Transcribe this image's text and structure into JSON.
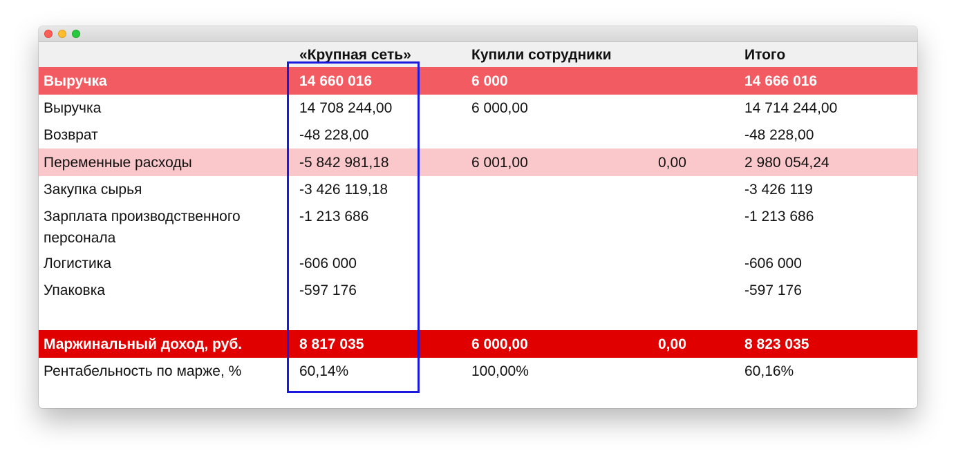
{
  "columns": {
    "label": "",
    "col1": "«Крупная сеть»",
    "col2": "Купили сотрудники",
    "col3": "",
    "total": "Итого"
  },
  "rows": [
    {
      "label": "Выручка",
      "col1": "14 660 016",
      "col2": "6 000",
      "col3": "",
      "total": "14 666 016"
    },
    {
      "label": "Выручка",
      "col1": "14 708 244,00",
      "col2": "6 000,00",
      "col3": "",
      "total": "14 714 244,00"
    },
    {
      "label": "Возврат",
      "col1": "-48 228,00",
      "col2": "",
      "col3": "",
      "total": "-48 228,00"
    },
    {
      "label": "Переменные расходы",
      "col1": "-5 842 981,18",
      "col2": "6 001,00",
      "col3": "0,00",
      "total": "2 980 054,24"
    },
    {
      "label": "Закупка сырья",
      "col1": "-3 426 119,18",
      "col2": "",
      "col3": "",
      "total": "-3 426 119"
    },
    {
      "label": "Зарплата производственного персонала",
      "col1": "-1 213 686",
      "col2": "",
      "col3": "",
      "total": "-1 213 686"
    },
    {
      "label": "Логистика",
      "col1": "-606 000",
      "col2": "",
      "col3": "",
      "total": "-606 000"
    },
    {
      "label": "Упаковка",
      "col1": "-597 176",
      "col2": "",
      "col3": "",
      "total": "-597 176"
    },
    {
      "label": "Маржинальный доход, руб.",
      "col1": "8 817 035",
      "col2": "6 000,00",
      "col3": "0,00",
      "total": "8 823 035"
    },
    {
      "label": "Рентабельность по марже, %",
      "col1": "60,14%",
      "col2": "100,00%",
      "col3": "",
      "total": "60,16%"
    }
  ],
  "colors": {
    "revenue_row": "#f35b62",
    "variable_row": "#fac8ca",
    "margin_row": "#e00000",
    "highlight_border": "#1a1adf"
  }
}
